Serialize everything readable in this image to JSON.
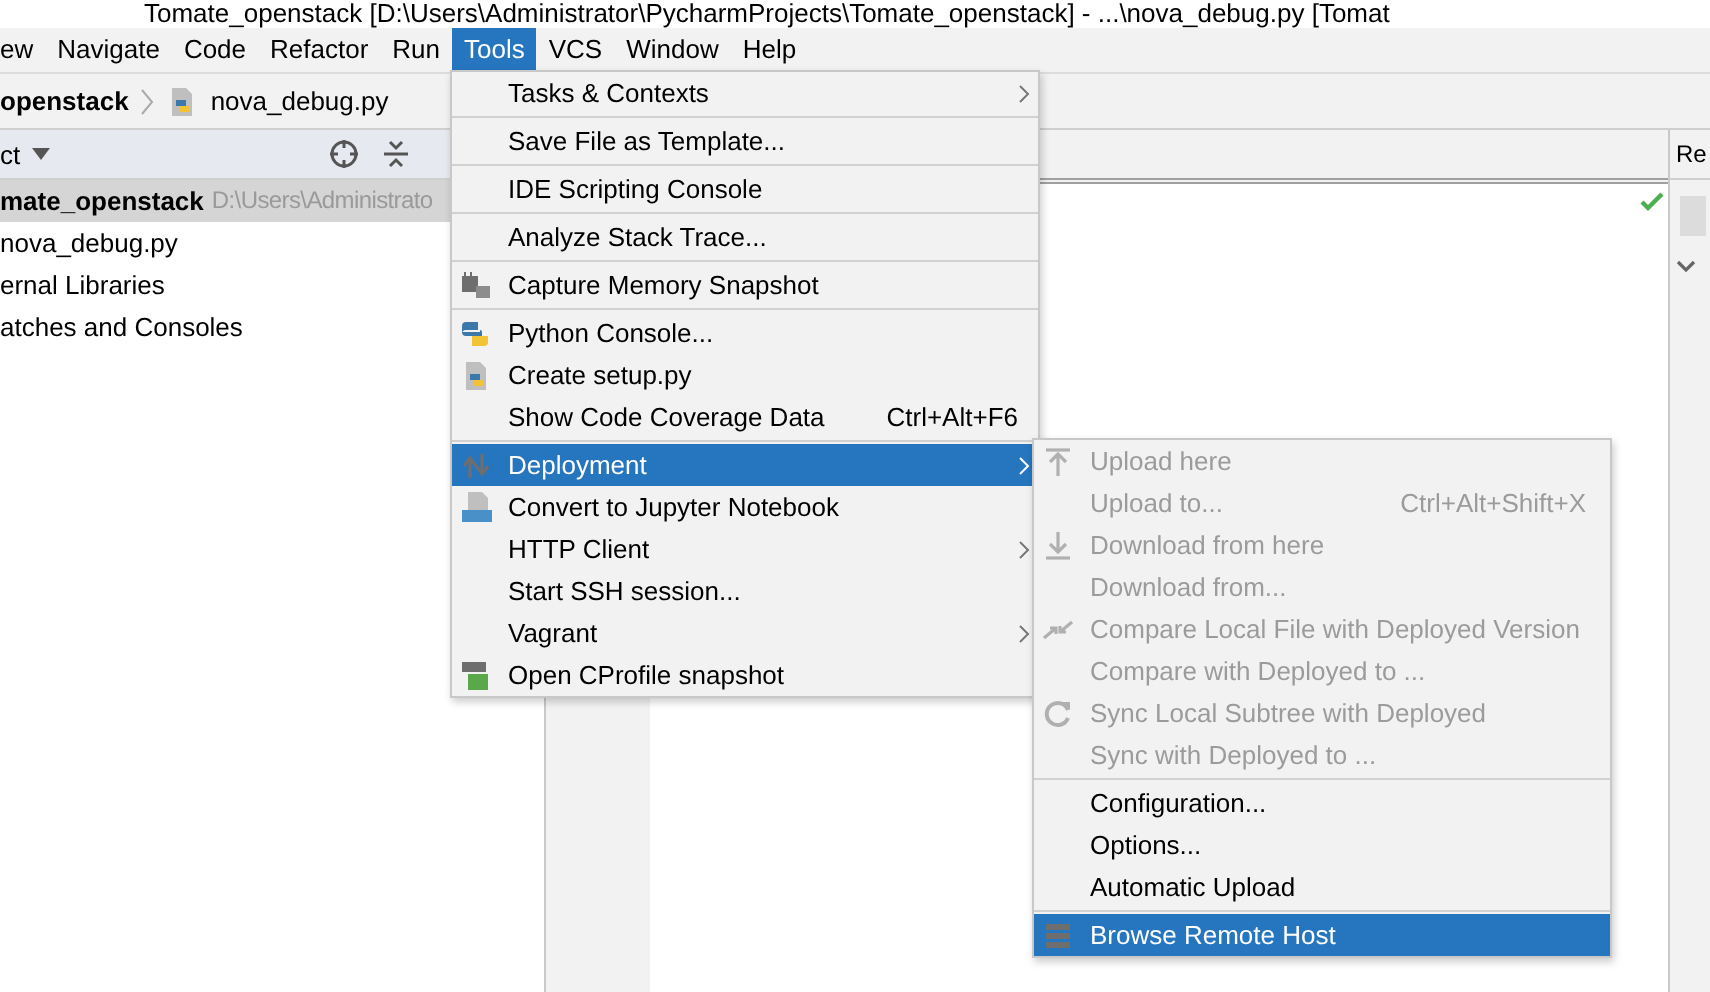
{
  "window": {
    "title": "Tomate_openstack [D:\\Users\\Administrator\\PycharmProjects\\Tomate_openstack] - ...\\nova_debug.py [Tomat"
  },
  "menu_bar": [
    {
      "label": "ew",
      "selected": false
    },
    {
      "label": "Navigate",
      "selected": false
    },
    {
      "label": "Code",
      "selected": false
    },
    {
      "label": "Refactor",
      "selected": false
    },
    {
      "label": "Run",
      "selected": false
    },
    {
      "label": "Tools",
      "selected": true
    },
    {
      "label": "VCS",
      "selected": false
    },
    {
      "label": "Window",
      "selected": false
    },
    {
      "label": "Help",
      "selected": false
    }
  ],
  "breadcrumb": {
    "project": "openstack",
    "file": "nova_debug.py"
  },
  "project_panel": {
    "title": "ct",
    "rows": [
      {
        "label": "mate_openstack",
        "path": "D:\\Users\\Administrato",
        "selected": true
      },
      {
        "label": "nova_debug.py",
        "selected": false
      },
      {
        "label": "ernal Libraries",
        "selected": false
      },
      {
        "label": "atches and Consoles",
        "selected": false
      }
    ]
  },
  "right_panel": {
    "title": "Re"
  },
  "tools_menu": [
    {
      "kind": "item",
      "label": "Tasks & Contexts",
      "submenu": true,
      "selected": false
    },
    {
      "kind": "separator"
    },
    {
      "kind": "item",
      "label": "Save File as Template...",
      "selected": false
    },
    {
      "kind": "separator"
    },
    {
      "kind": "item",
      "label": "IDE Scripting Console",
      "selected": false
    },
    {
      "kind": "separator"
    },
    {
      "kind": "item",
      "label": "Analyze Stack Trace...",
      "selected": false
    },
    {
      "kind": "separator"
    },
    {
      "kind": "item",
      "label": "Capture Memory Snapshot",
      "selected": false
    },
    {
      "kind": "separator"
    },
    {
      "kind": "item",
      "label": "Python Console...",
      "selected": false
    },
    {
      "kind": "item",
      "label": "Create setup.py",
      "selected": false
    },
    {
      "kind": "item",
      "label": "Show Code Coverage Data",
      "shortcut": "Ctrl+Alt+F6",
      "selected": false
    },
    {
      "kind": "separator"
    },
    {
      "kind": "item",
      "label": "Deployment",
      "submenu": true,
      "selected": true
    },
    {
      "kind": "item",
      "label": "Convert to Jupyter Notebook",
      "selected": false
    },
    {
      "kind": "item",
      "label": "HTTP Client",
      "submenu": true,
      "selected": false
    },
    {
      "kind": "item",
      "label": "Start SSH session...",
      "selected": false
    },
    {
      "kind": "item",
      "label": "Vagrant",
      "submenu": true,
      "selected": false
    },
    {
      "kind": "item",
      "label": "Open CProfile snapshot",
      "selected": false
    }
  ],
  "deployment_submenu": [
    {
      "kind": "item",
      "label": "Upload here",
      "disabled": true,
      "selected": false
    },
    {
      "kind": "item",
      "label": "Upload to...",
      "shortcut": "Ctrl+Alt+Shift+X",
      "disabled": true,
      "selected": false
    },
    {
      "kind": "item",
      "label": "Download from here",
      "disabled": true,
      "selected": false
    },
    {
      "kind": "item",
      "label": "Download from...",
      "disabled": true,
      "selected": false
    },
    {
      "kind": "item",
      "label": "Compare Local File with Deployed Version",
      "disabled": true,
      "selected": false
    },
    {
      "kind": "item",
      "label": "Compare with Deployed to ...",
      "disabled": true,
      "selected": false
    },
    {
      "kind": "item",
      "label": "Sync Local Subtree with Deployed",
      "disabled": true,
      "selected": false
    },
    {
      "kind": "item",
      "label": "Sync with Deployed to ...",
      "disabled": true,
      "selected": false
    },
    {
      "kind": "separator"
    },
    {
      "kind": "item",
      "label": "Configuration...",
      "disabled": false,
      "selected": false
    },
    {
      "kind": "item",
      "label": "Options...",
      "disabled": false,
      "selected": false
    },
    {
      "kind": "item",
      "label": "Automatic Upload",
      "disabled": false,
      "selected": false
    },
    {
      "kind": "separator"
    },
    {
      "kind": "item",
      "label": "Browse Remote Host",
      "disabled": false,
      "selected": true
    }
  ]
}
